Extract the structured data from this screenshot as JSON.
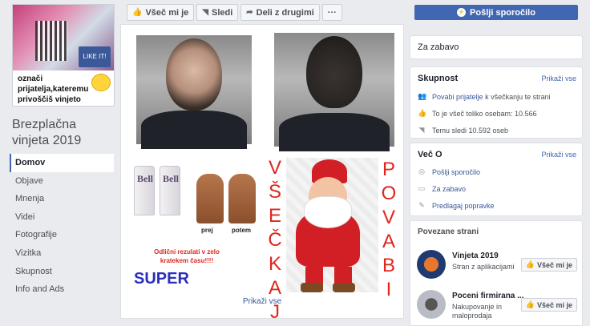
{
  "cover": {
    "caption_line1": "označi",
    "caption_line2": "prijatelja,kateremu",
    "caption_line3": "privoščiš vinjeto"
  },
  "page": {
    "name": "Brezplačna vinjeta 2019"
  },
  "nav": {
    "items": [
      "Domov",
      "Objave",
      "Mnenja",
      "Videi",
      "Fotografije",
      "Vizitka",
      "Skupnost",
      "Info and Ads"
    ]
  },
  "actions": {
    "like": "Všeč mi je",
    "follow": "Sledi",
    "share": "Deli z drugimi",
    "more": "···",
    "message": "Pošlji sporočilo"
  },
  "photos": {
    "promo_line1": "Odlični rezulati v zelo",
    "promo_line2": "kratekem času!!!!",
    "super": "SUPER",
    "before": "prej",
    "after": "potem",
    "brand": "Bell",
    "left_vertical": [
      "V",
      "Š",
      "E",
      "Č",
      "K",
      "A",
      "J"
    ],
    "right_vertical": [
      "P",
      "O",
      "V",
      "A",
      "B",
      "I"
    ],
    "show_all": "Prikaži vse"
  },
  "category": {
    "label": "Za zabavo"
  },
  "community": {
    "title": "Skupnost",
    "show_all": "Prikaži vse",
    "invite": "Povabi prijatelje",
    "invite_rest": "k všečkanju te strani",
    "likes": "To je všeč toliko osebam: 10.566",
    "follows": "Temu sledi 10.592 oseb"
  },
  "more": {
    "title": "Več O",
    "show_all": "Prikaži vse",
    "send_message": "Pošlji sporočilo",
    "category": "Za zabavo",
    "suggest": "Predlagaj popravke"
  },
  "related": {
    "title": "Povezane strani",
    "items": [
      {
        "name": "Vinjeta 2019",
        "sub": "Stran z aplikacijami",
        "like": "Všeč mi je"
      },
      {
        "name": "Poceni firmirana ...",
        "sub": "Nakupovanje in maloprodaja",
        "like": "Všeč mi je"
      }
    ]
  }
}
